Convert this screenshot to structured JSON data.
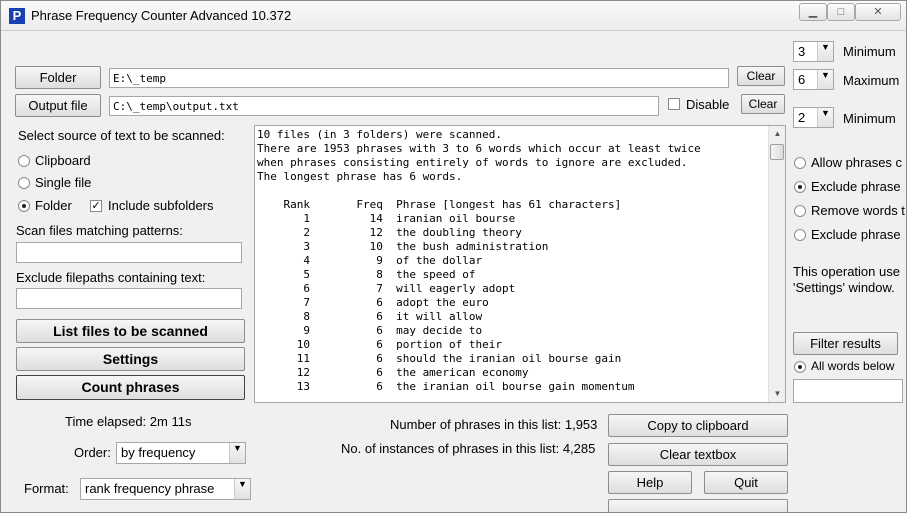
{
  "window": {
    "title": "Phrase Frequency Counter Advanced 10.372",
    "app_icon_letter": "P"
  },
  "left": {
    "folder_button": "Folder",
    "folder_path": "E:\\_temp",
    "folder_clear": "Clear",
    "output_button": "Output file",
    "output_path": "C:\\_temp\\output.txt",
    "disable_label": "Disable",
    "output_clear": "Clear",
    "source_heading": "Select source of text to be scanned:",
    "source_options": [
      "Clipboard",
      "Single file",
      "Folder"
    ],
    "include_subfolders": "Include subfolders",
    "scan_patterns_label": "Scan files matching patterns:",
    "exclude_label": "Exclude filepaths containing text:",
    "list_files_button": "List files to be scanned",
    "settings_button": "Settings",
    "count_button": "Count phrases",
    "time_elapsed": "Time elapsed: 2m 11s",
    "order_label": "Order:",
    "order_value": "by frequency",
    "format_label": "Format:",
    "format_value": "rank frequency phrase"
  },
  "results": {
    "summary": [
      "10 files (in 3 folders) were scanned.",
      "There are 1953 phrases with 3 to 6 words which occur at least twice",
      "when phrases consisting entirely of words to ignore are excluded.",
      "The longest phrase has 6 words."
    ],
    "header": {
      "rank": "Rank",
      "freq": "Freq",
      "phrase": "Phrase [longest has 61 characters]"
    },
    "rows": [
      {
        "rank": "1",
        "freq": "14",
        "phrase": "iranian oil bourse"
      },
      {
        "rank": "2",
        "freq": "12",
        "phrase": "the doubling theory"
      },
      {
        "rank": "3",
        "freq": "10",
        "phrase": "the bush administration"
      },
      {
        "rank": "4",
        "freq": "9",
        "phrase": "of the dollar"
      },
      {
        "rank": "5",
        "freq": "8",
        "phrase": "the speed of"
      },
      {
        "rank": "6",
        "freq": "7",
        "phrase": "will eagerly adopt"
      },
      {
        "rank": "7",
        "freq": "6",
        "phrase": "adopt the euro"
      },
      {
        "rank": "8",
        "freq": "6",
        "phrase": "it will allow"
      },
      {
        "rank": "9",
        "freq": "6",
        "phrase": "may decide to"
      },
      {
        "rank": "10",
        "freq": "6",
        "phrase": "portion of their"
      },
      {
        "rank": "11",
        "freq": "6",
        "phrase": "should the iranian oil bourse gain"
      },
      {
        "rank": "12",
        "freq": "6",
        "phrase": "the american economy"
      },
      {
        "rank": "13",
        "freq": "6",
        "phrase": "the iranian oil bourse gain momentum"
      }
    ]
  },
  "bottom": {
    "num_phrases": "Number of phrases in this list: 1,953",
    "num_instances": "No. of instances of phrases in this list: 4,285",
    "copy_button": "Copy to clipboard",
    "clear_textbox_button": "Clear textbox",
    "help_button": "Help",
    "quit_button": "Quit"
  },
  "right": {
    "min_words": "3",
    "min_label": "Minimum",
    "max_words": "6",
    "max_label": "Maximum",
    "min_freq": "2",
    "min_freq_label": "Minimum",
    "options": [
      "Allow phrases c",
      "Exclude phrase",
      "Remove words t",
      "Exclude phrase"
    ],
    "info_line1": "This operation use",
    "info_line2": "'Settings' window.",
    "filter_button": "Filter results",
    "all_words_label": "All words below"
  }
}
